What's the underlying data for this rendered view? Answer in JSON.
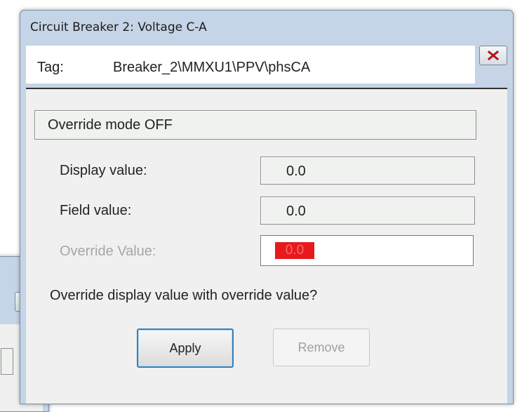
{
  "window": {
    "title": "Circuit Breaker 2: Voltage C-A",
    "close_icon": "close-x-icon"
  },
  "tag": {
    "label": "Tag:",
    "value": "Breaker_2\\MMXU1\\PPV\\phsCA"
  },
  "override_status": "Override mode OFF",
  "fields": {
    "display": {
      "label": "Display value:",
      "value": "0.0"
    },
    "field": {
      "label": "Field value:",
      "value": "0.0"
    },
    "override": {
      "label": "Override Value:",
      "value": "0.0",
      "selection_color": "#e8191d"
    }
  },
  "question": "Override display value with override value?",
  "buttons": {
    "apply": "Apply",
    "remove": "Remove"
  },
  "colors": {
    "titlebar": "#c5d4e6",
    "selection": "#e8191d",
    "default_button_border": "#3c7fb1"
  }
}
